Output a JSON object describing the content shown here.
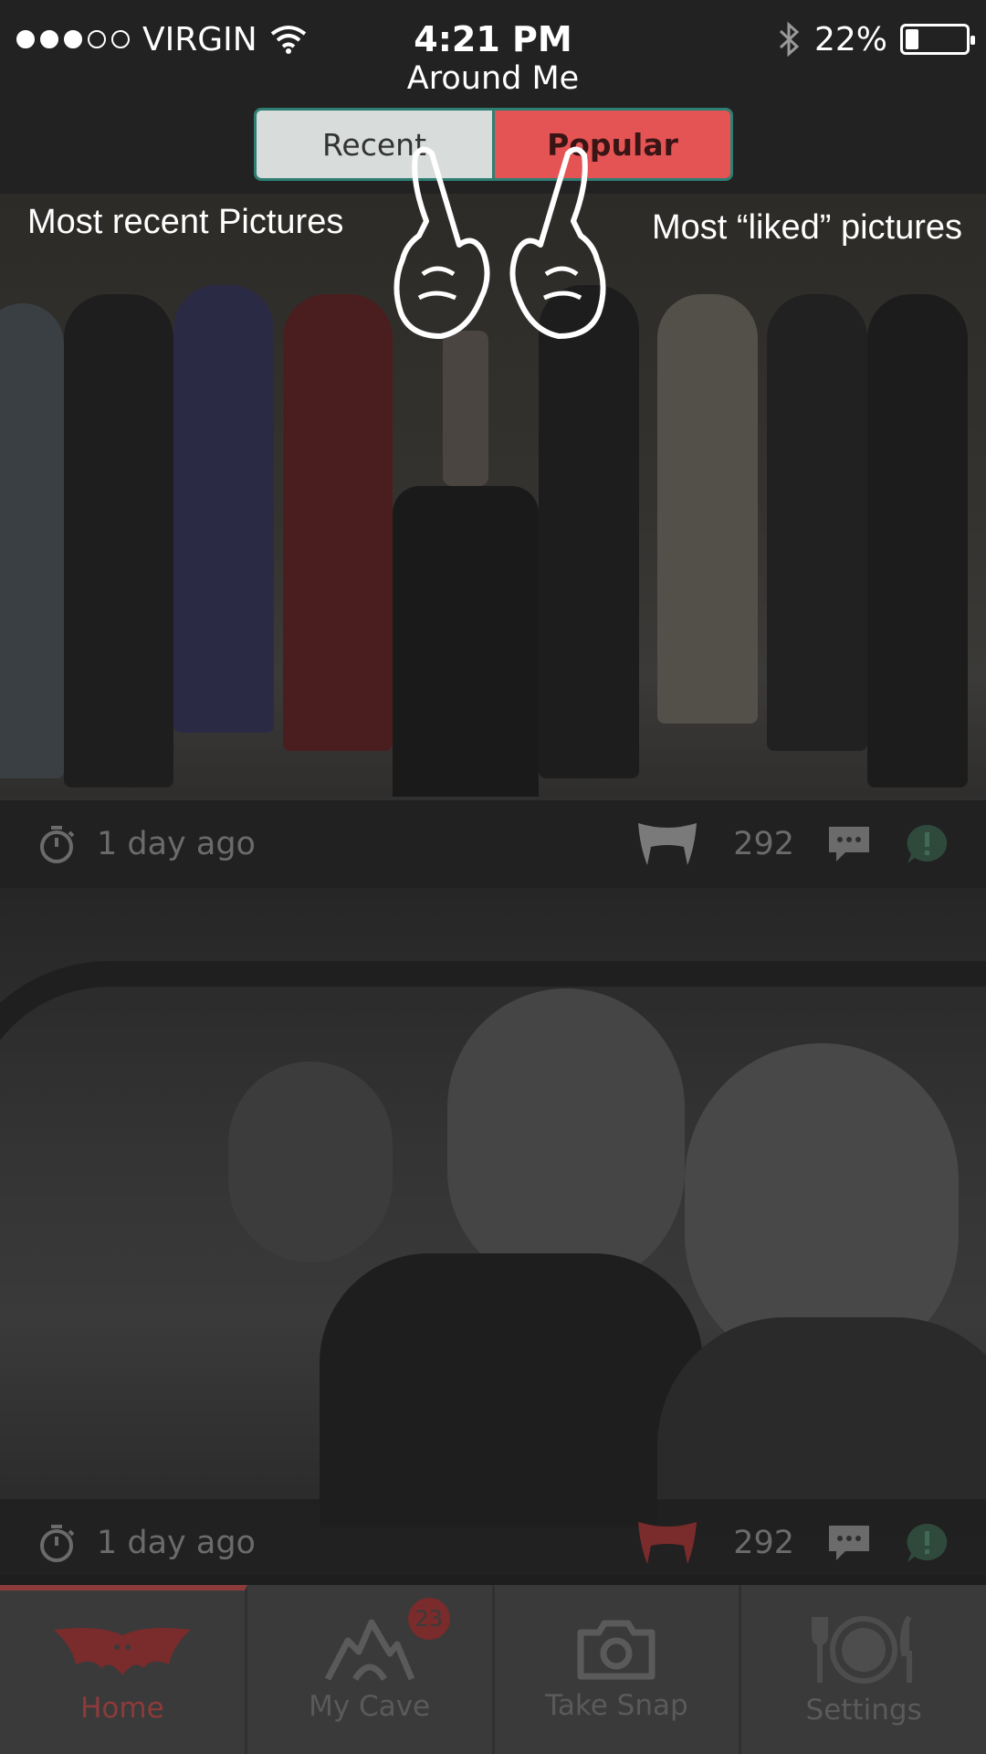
{
  "status_bar": {
    "carrier": "VIRGIN",
    "time": "4:21 PM",
    "battery": "22%",
    "battery_level": 0.22
  },
  "header": {
    "title": "Around Me",
    "segments": [
      {
        "label": "Recent",
        "selected": false
      },
      {
        "label": "Popular",
        "selected": true
      }
    ]
  },
  "overlay": {
    "recent_hint": "Most recent Pictures",
    "popular_hint": "Most “liked” pictures"
  },
  "feed": [
    {
      "time": "1 day ago",
      "likes": "292"
    },
    {
      "time": "1 day ago",
      "likes": "292"
    }
  ],
  "tabs": [
    {
      "label": "Home",
      "active": true,
      "icon": "bat-icon"
    },
    {
      "label": "My Cave",
      "active": false,
      "icon": "mountain-icon",
      "badge": "23"
    },
    {
      "label": "Take Snap",
      "active": false,
      "icon": "camera-icon"
    },
    {
      "label": "Settings",
      "active": false,
      "icon": "plate-cutlery-icon"
    }
  ],
  "colors": {
    "accent": "#e55454",
    "segment_border": "#2e7f73",
    "tab_active": "#8d3a3a"
  }
}
